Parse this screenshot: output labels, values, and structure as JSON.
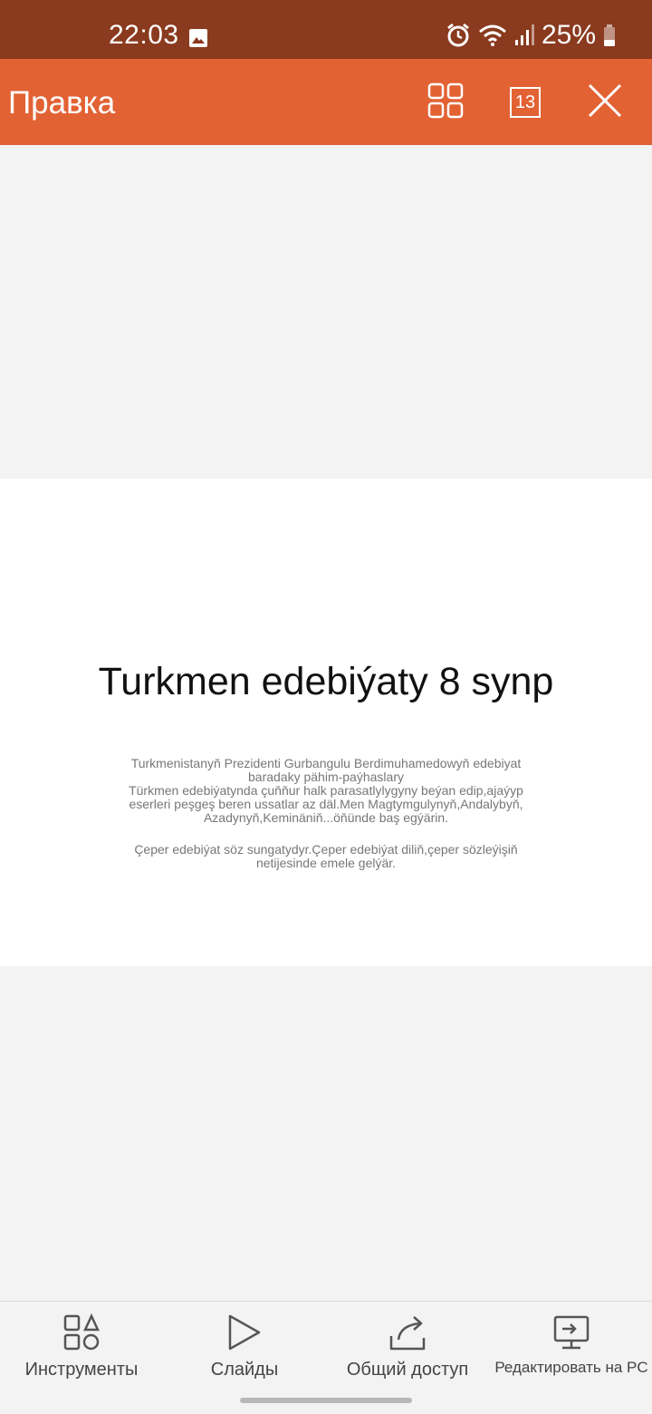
{
  "status_bar": {
    "time": "22:03",
    "battery": "25%",
    "icons": [
      "gallery-icon",
      "alarm-icon",
      "wifi-icon",
      "signal-icon",
      "battery-icon"
    ]
  },
  "app_bar": {
    "title": "Правка",
    "page_count": "13",
    "icons": [
      "grid-view-icon",
      "page-count-icon",
      "close-icon"
    ]
  },
  "slide": {
    "title": "Turkmen edebiýaty 8 synp",
    "paragraphs": [
      "Turkmenistanyň Prezidenti Gurbangulu Berdimuhamedowyň edebiyat baradaky pähim-paýhaslary",
      "Türkmen edebiýatynda çuňňur halk parasatlylygyny beýan edip,ajaýyp eserleri peşgeş beren ussatlar az däl.Men Magtymgulynyň,Andalybyň, Azadynyň,Keminäniň...öňünde baş egýärin.",
      "Çeper edebiýat söz sungatydyr.Çeper edebiýat diliň,çeper sözleýişiň netijesinde emele gelýär."
    ]
  },
  "bottom_bar": {
    "tools_label": "Инструменты",
    "slides_label": "Слайды",
    "share_label": "Общий доступ",
    "edit_pc_label": "Редактировать на PC"
  },
  "colors": {
    "status_bar": "#8a3a1e",
    "app_bar": "#e26234",
    "canvas": "#f3f3f3"
  }
}
